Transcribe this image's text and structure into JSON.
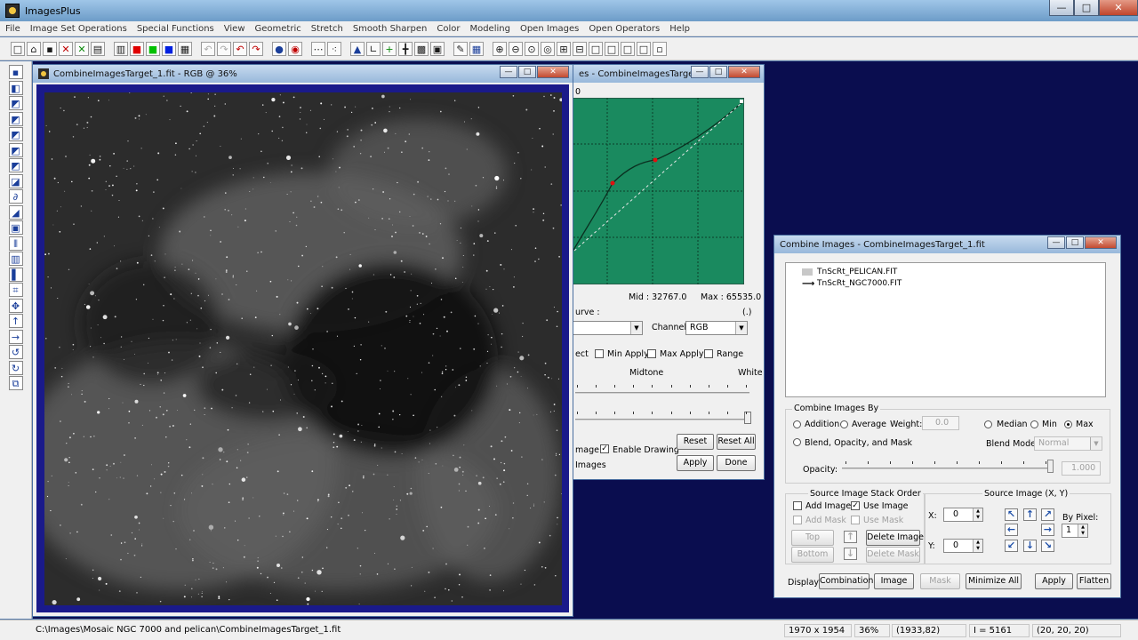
{
  "app": {
    "title": "ImagesPlus",
    "caption": {
      "minimize": "—",
      "maximize": "□",
      "close": "✕"
    }
  },
  "menu": [
    "File",
    "Image Set Operations",
    "Special Functions",
    "View",
    "Geometric",
    "Stretch",
    "Smooth Sharpen",
    "Color",
    "Modeling",
    "Open Images",
    "Open Operators",
    "Help"
  ],
  "toolbar": [
    {
      "icon": "new-file-icon",
      "glyph": "□"
    },
    {
      "icon": "open-folder-icon",
      "glyph": "⌂"
    },
    {
      "icon": "save-icon",
      "glyph": "▪"
    },
    {
      "icon": "close-red-x-icon",
      "glyph": "✕"
    },
    {
      "icon": "close-green-x-icon",
      "glyph": "✕"
    },
    {
      "icon": "print-icon",
      "glyph": "▤"
    },
    {
      "icon": "rgb-channels-icon",
      "glyph": "▥"
    },
    {
      "icon": "red-channel-icon",
      "glyph": "■"
    },
    {
      "icon": "green-channel-icon",
      "glyph": "■"
    },
    {
      "icon": "blue-channel-icon",
      "glyph": "■"
    },
    {
      "icon": "grid-icon",
      "glyph": "▦"
    },
    {
      "icon": "undo-gray-icon",
      "glyph": "↶"
    },
    {
      "icon": "redo-gray-icon",
      "glyph": "↷"
    },
    {
      "icon": "undo-icon",
      "glyph": "↶"
    },
    {
      "icon": "redo-icon",
      "glyph": "↷"
    },
    {
      "icon": "record-icon",
      "glyph": "●"
    },
    {
      "icon": "stop-icon",
      "glyph": "◉"
    },
    {
      "icon": "dots-icon",
      "glyph": "⋯"
    },
    {
      "icon": "star-selection-icon",
      "glyph": "⁖"
    },
    {
      "icon": "histogram-icon",
      "glyph": "▲"
    },
    {
      "icon": "curve-icon",
      "glyph": "∟"
    },
    {
      "icon": "crosshair-icon",
      "glyph": "+"
    },
    {
      "icon": "crosshair-target-icon",
      "glyph": "╋"
    },
    {
      "icon": "grid-overlay-icon",
      "glyph": "▩"
    },
    {
      "icon": "picture-icon",
      "glyph": "▣"
    },
    {
      "icon": "pencil-icon",
      "glyph": "✎"
    },
    {
      "icon": "table-icon",
      "glyph": "▦"
    },
    {
      "icon": "zoom-in-icon",
      "glyph": "⊕"
    },
    {
      "icon": "zoom-out-icon",
      "glyph": "⊖"
    },
    {
      "icon": "zoom-fit-icon",
      "glyph": "⊙"
    },
    {
      "icon": "zoom-actual-icon",
      "glyph": "◎"
    },
    {
      "icon": "add-box-icon",
      "glyph": "⊞"
    },
    {
      "icon": "remove-box-icon",
      "glyph": "⊟"
    },
    {
      "icon": "rect-select-icon",
      "glyph": "□"
    },
    {
      "icon": "rect-select-2-icon",
      "glyph": "□"
    },
    {
      "icon": "rect-select-3-icon",
      "glyph": "□"
    },
    {
      "icon": "rect-select-4-icon",
      "glyph": "□"
    },
    {
      "icon": "rect-select-5-icon",
      "glyph": "▫"
    }
  ],
  "left_tools": [
    {
      "icon": "save-small-icon",
      "glyph": "▪"
    },
    {
      "icon": "color-swap-icon",
      "glyph": "◧"
    },
    {
      "icon": "red-black-icon",
      "glyph": "◩"
    },
    {
      "icon": "green-black-icon",
      "glyph": "◩"
    },
    {
      "icon": "blue-black-icon",
      "glyph": "◩"
    },
    {
      "icon": "cyan-black-icon",
      "glyph": "◩"
    },
    {
      "icon": "teal-black-icon",
      "glyph": "◩"
    },
    {
      "icon": "black-white-icon",
      "glyph": "◪"
    },
    {
      "icon": "gray-brush-icon",
      "glyph": "∂"
    },
    {
      "icon": "gradient-icon",
      "glyph": "◢"
    },
    {
      "icon": "frame-icon",
      "glyph": "▣"
    },
    {
      "icon": "level-bars-icon",
      "glyph": "⦀"
    },
    {
      "icon": "bars-icon",
      "glyph": "▥"
    },
    {
      "icon": "black-bar-icon",
      "glyph": "▌"
    },
    {
      "icon": "crop-icon",
      "glyph": "⌗"
    },
    {
      "icon": "move-icon",
      "glyph": "✥"
    },
    {
      "icon": "arrow-up-icon",
      "glyph": "↑"
    },
    {
      "icon": "arrow-right-icon",
      "glyph": "→"
    },
    {
      "icon": "rotate-left-icon",
      "glyph": "↺"
    },
    {
      "icon": "rotate-right-icon",
      "glyph": "↻"
    },
    {
      "icon": "copy-icon",
      "glyph": "⧉"
    }
  ],
  "image_window": {
    "title": "CombineImagesTarget_1.fit - RGB @ 36%"
  },
  "curves_window": {
    "title_fragment": "es - CombineImagesTarget...",
    "zero_label": "0",
    "mid_label": "Mid :  32767.0",
    "max_label": "Max :  65535.0",
    "curve_label": "urve :",
    "curve_hint": "(.)",
    "channel_label": "Channel:",
    "channel_value": "RGB",
    "ect_label": "ect",
    "min_apply": "Min Apply",
    "max_apply": "Max Apply",
    "range": "Range",
    "midtone_label": "Midtone",
    "white_label": "White",
    "image_label": "mage",
    "enable_drawing": "Enable Drawing",
    "images_label": "Images",
    "reset_btn": "Reset",
    "reset_all_btn": "Reset All",
    "apply_btn": "Apply",
    "done_btn": "Done",
    "enable_drawing_checked": true
  },
  "combine_window": {
    "title": "Combine Images - CombineImagesTarget_1.fit",
    "sources": [
      {
        "name": "TnScRt_PELICAN.FIT",
        "marker": "gray-box"
      },
      {
        "name": "TnScRt_NGC7000.FIT",
        "marker": "arrow"
      }
    ],
    "group_title": "Combine Images By",
    "addition": "Addition",
    "average": "Average",
    "weight_label": "Weight:",
    "weight_value": "0.0",
    "median": "Median",
    "min": "Min",
    "max": "Max",
    "blend": "Blend, Opacity, and Mask",
    "blend_mode_label": "Blend Mode:",
    "blend_mode_value": "Normal",
    "opacity_label": "Opacity:",
    "opacity_value": "1.000",
    "stack_title": "Source Image Stack Order",
    "add_image": "Add Image",
    "use_image": "Use Image",
    "add_mask": "Add Mask",
    "use_mask": "Use Mask",
    "top_btn": "Top",
    "bottom_btn": "Bottom",
    "delete_image_btn": "Delete Image",
    "delete_mask_btn": "Delete Mask",
    "source_xy_title": "Source Image (X, Y)",
    "x_label": "X:",
    "x_value": "0",
    "y_label": "Y:",
    "y_value": "0",
    "by_pixel_label": "By Pixel:",
    "by_pixel_value": "1",
    "display_label": "Display:",
    "combination_btn": "Combination",
    "image_btn": "Image",
    "mask_btn": "Mask",
    "minimize_all_btn": "Minimize All",
    "apply_btn": "Apply",
    "flatten_btn": "Flatten",
    "use_image_checked": true
  },
  "status": {
    "path": "C:\\Images\\Mosaic NGC 7000 and pelican\\CombineImagesTarget_1.fit",
    "dimensions": "1970 x 1954",
    "zoom": "36%",
    "coords": "(1933,82)",
    "intensity": "I = 5161",
    "rgb": "(20, 20, 20)"
  },
  "colors": {
    "workspace": "#0a0d4f",
    "curve_grid": "#1a8a5f",
    "image_border": "#1a1a8a"
  }
}
